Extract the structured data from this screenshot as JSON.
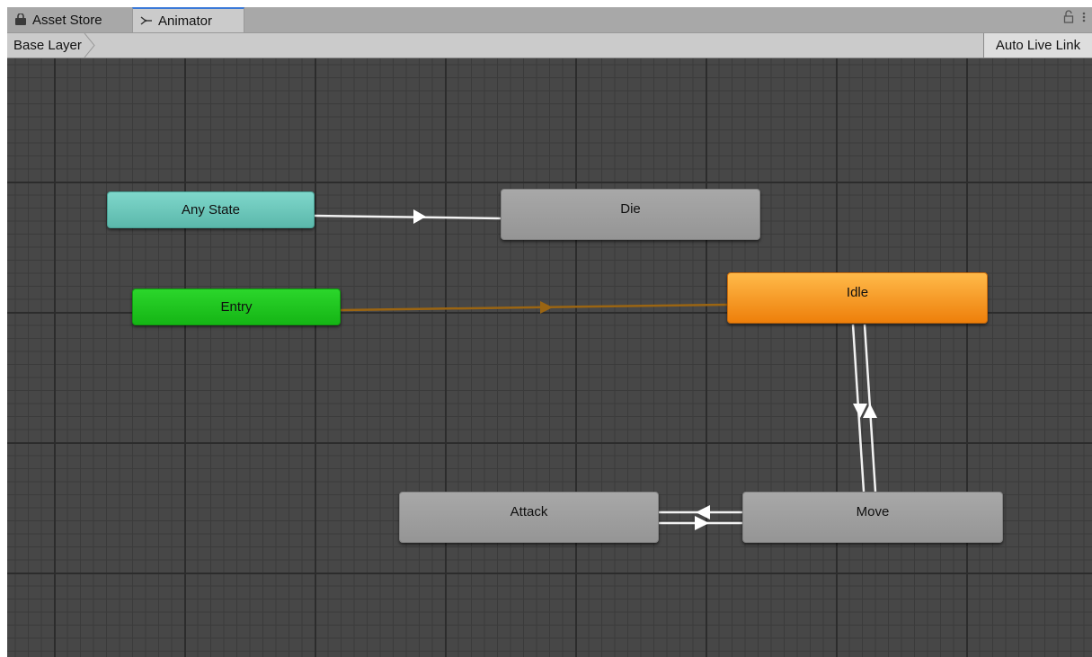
{
  "tabs": [
    {
      "label": "Asset Store",
      "icon": "lock-bag-icon",
      "active": false
    },
    {
      "label": "Animator",
      "icon": "animator-icon",
      "active": true
    }
  ],
  "toolbar": {
    "breadcrumb": "Base Layer",
    "auto_live_link": "Auto Live Link"
  },
  "states": {
    "any_state": "Any State",
    "entry": "Entry",
    "die": "Die",
    "idle": "Idle",
    "attack": "Attack",
    "move": "Move"
  },
  "transitions": [
    {
      "from": "Any State",
      "to": "Die"
    },
    {
      "from": "Entry",
      "to": "Idle"
    },
    {
      "from": "Idle",
      "to": "Move"
    },
    {
      "from": "Move",
      "to": "Idle"
    },
    {
      "from": "Move",
      "to": "Attack"
    },
    {
      "from": "Attack",
      "to": "Move"
    }
  ],
  "colors": {
    "any_state": "#6dcbbd",
    "entry": "#1fc81f",
    "default_state": "#a0a0a0",
    "idle": "#f59a25",
    "entry_transition": "#9b6512",
    "transition": "#ffffff",
    "active_tab_accent": "#3a79d8"
  }
}
